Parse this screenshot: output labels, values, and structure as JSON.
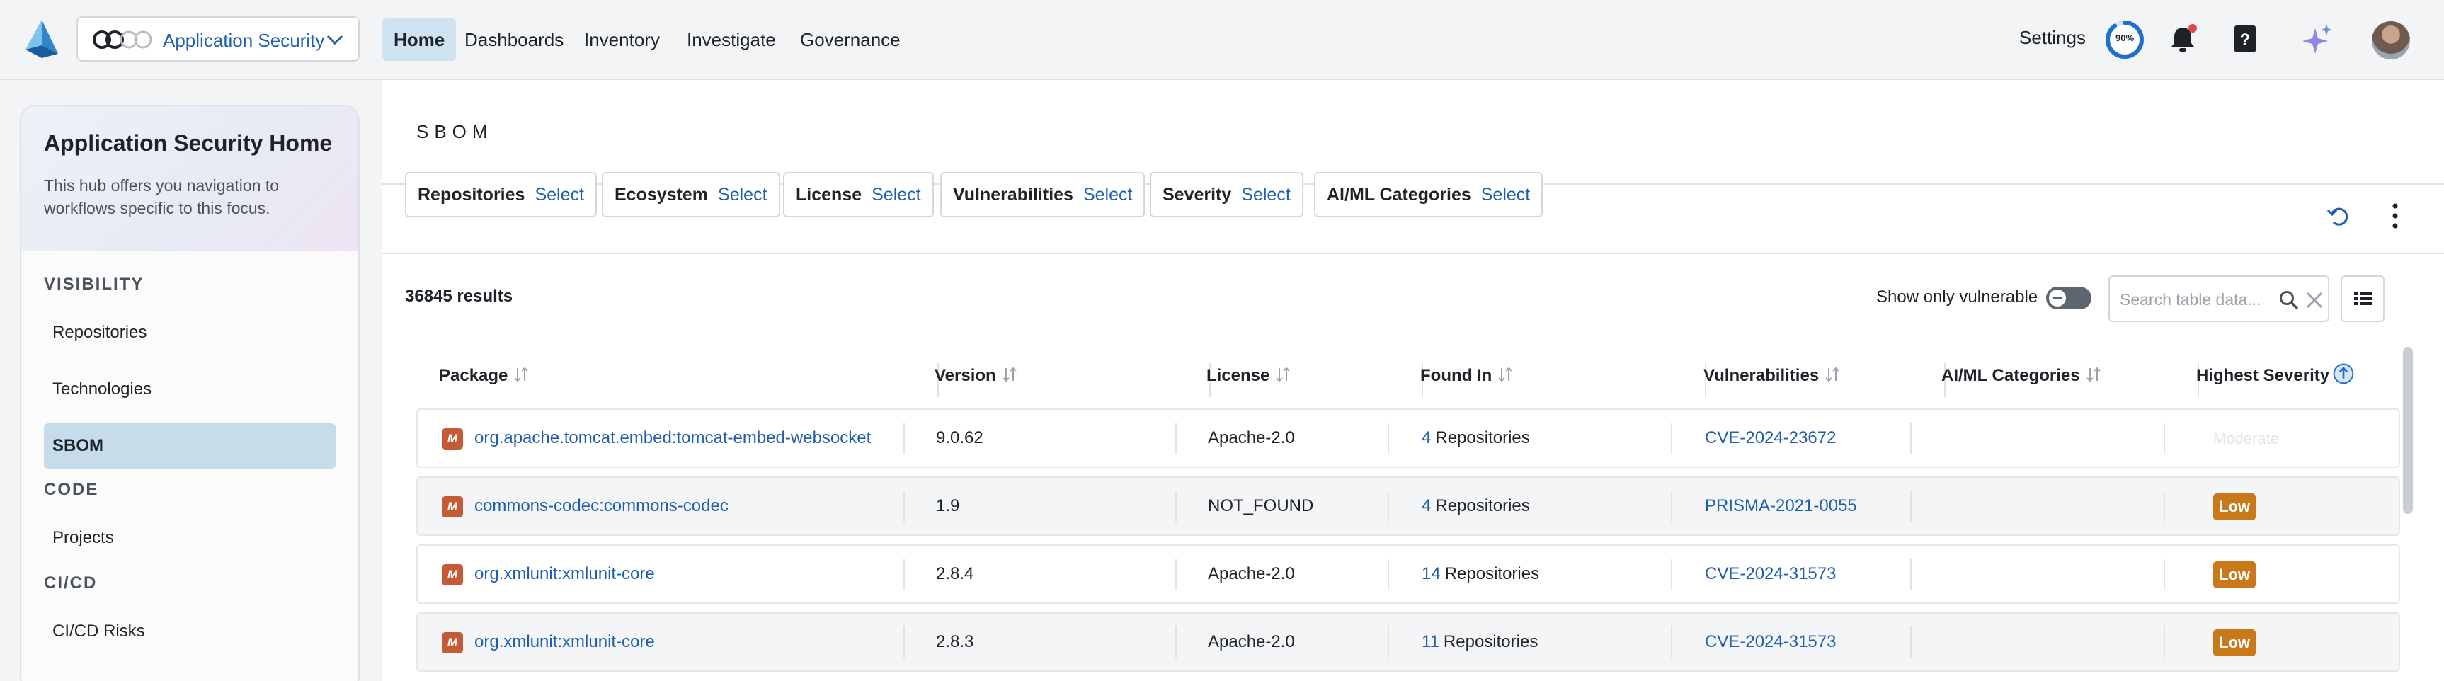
{
  "app": {
    "name": "Application Security",
    "colors": {
      "accent": "#1f5fae",
      "active_nav": "#cfe2ef",
      "severity_low": "#c9781a",
      "maven": "#c55a36"
    }
  },
  "nav": {
    "items": [
      {
        "label": "Home",
        "active": true
      },
      {
        "label": "Dashboards"
      },
      {
        "label": "Inventory"
      },
      {
        "label": "Investigate"
      },
      {
        "label": "Governance"
      }
    ],
    "settings_label": "Settings",
    "progress_pct": "90%",
    "progress_value": 0.9,
    "icons": [
      "bell-icon",
      "help-book-icon",
      "sparkle-ai-icon",
      "avatar"
    ]
  },
  "sidebar": {
    "title": "Application Security Home",
    "description": "This hub offers you navigation to workflows specific to this focus.",
    "sections": [
      {
        "title": "VISIBILITY",
        "items": [
          "Repositories",
          "Technologies",
          "SBOM"
        ]
      },
      {
        "title": "CODE",
        "items": [
          "Projects"
        ]
      },
      {
        "title": "CI/CD",
        "items": [
          "CI/CD Risks"
        ]
      }
    ],
    "active_item": "SBOM"
  },
  "main": {
    "title": "SBOM",
    "filters": [
      {
        "label": "Repositories",
        "value": "Select"
      },
      {
        "label": "Ecosystem",
        "value": "Select"
      },
      {
        "label": "License",
        "value": "Select"
      },
      {
        "label": "Vulnerabilities",
        "value": "Select"
      },
      {
        "label": "Severity",
        "value": "Select"
      },
      {
        "label": "AI/ML Categories",
        "value": "Select"
      }
    ],
    "results_count": "36845 results",
    "show_only_vulnerable_label": "Show only vulnerable",
    "show_only_vulnerable": false,
    "search_placeholder": "Search table data..."
  },
  "table": {
    "columns": [
      "Package",
      "Version",
      "License",
      "Found In",
      "Vulnerabilities",
      "AI/ML Categories",
      "Highest Severity"
    ],
    "rows": [
      {
        "ecosystem": "M",
        "package": "org.apache.tomcat.embed:tomcat-embed-websocket",
        "version": "9.0.62",
        "license": "Apache-2.0",
        "found_count": "4",
        "found_label": "Repositories",
        "vulnerability": "CVE-2024-23672",
        "ai_ml": "",
        "severity": "Moderate"
      },
      {
        "ecosystem": "M",
        "package": "commons-codec:commons-codec",
        "version": "1.9",
        "license": "NOT_FOUND",
        "found_count": "4",
        "found_label": "Repositories",
        "vulnerability": "PRISMA-2021-0055",
        "ai_ml": "",
        "severity": "Low"
      },
      {
        "ecosystem": "M",
        "package": "org.xmlunit:xmlunit-core",
        "version": "2.8.4",
        "license": "Apache-2.0",
        "found_count": "14",
        "found_label": "Repositories",
        "vulnerability": "CVE-2024-31573",
        "ai_ml": "",
        "severity": "Low"
      },
      {
        "ecosystem": "M",
        "package": "org.xmlunit:xmlunit-core",
        "version": "2.8.3",
        "license": "Apache-2.0",
        "found_count": "11",
        "found_label": "Repositories",
        "vulnerability": "CVE-2024-31573",
        "ai_ml": "",
        "severity": "Low"
      }
    ]
  }
}
